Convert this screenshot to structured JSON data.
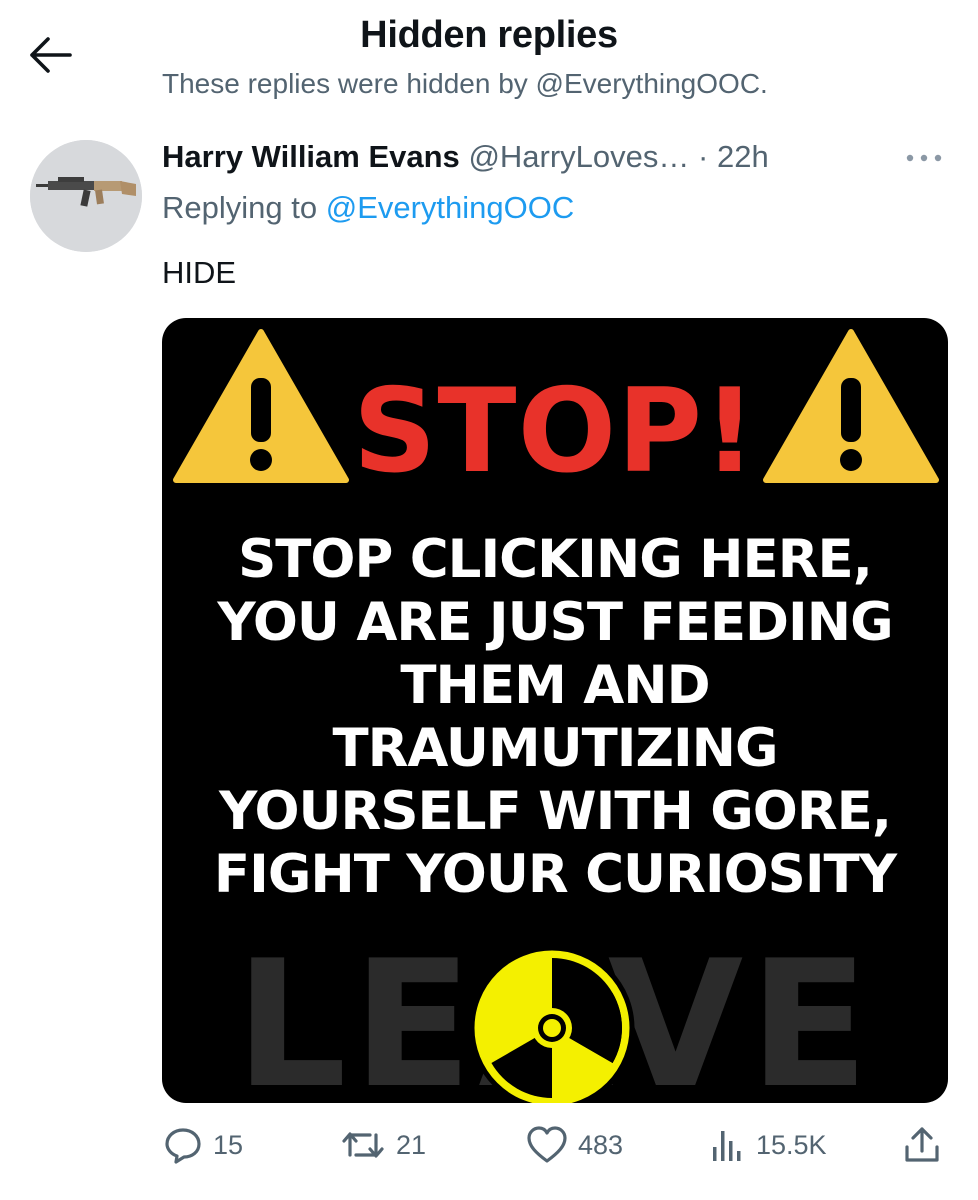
{
  "header": {
    "title": "Hidden replies",
    "subtitle": "These replies were hidden by @EverythingOOC."
  },
  "tweet": {
    "author_name": "Harry William Evans",
    "author_handle": "@HarryLoves…",
    "separator": "·",
    "time": "22h",
    "replying_prefix": "Replying to",
    "replying_to": "@EverythingOOC",
    "text": "HIDE",
    "avatar_icon": "rifle-avatar",
    "media": {
      "headline": "STOP!",
      "lines": [
        "STOP CLICKING HERE,",
        "YOU ARE JUST FEEDING",
        "THEM AND",
        "TRAUMUTIZING",
        "YOURSELF WITH GORE,",
        "FIGHT YOUR CURIOSITY"
      ],
      "background_word": "LEAVE",
      "colors": {
        "stop": "#e8322a",
        "warning": "#f5c63b",
        "radiation": "#f4f000"
      }
    },
    "actions": {
      "replies": "15",
      "reposts": "21",
      "likes": "483",
      "views": "15.5K"
    }
  },
  "colors": {
    "accent": "#1d9bf0",
    "muted": "#536471",
    "text": "#0f1419"
  }
}
